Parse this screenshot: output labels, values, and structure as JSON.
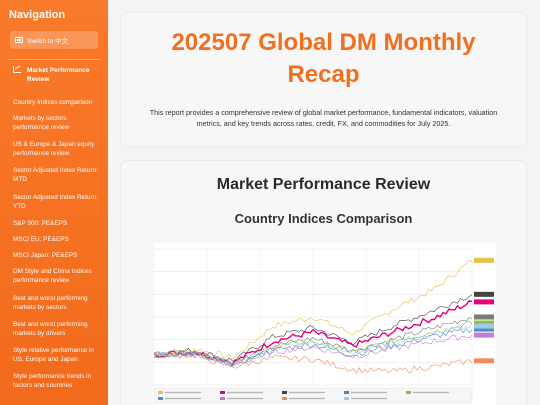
{
  "sidebar": {
    "title": "Navigation",
    "switch_label": "Switch to 中文",
    "active_item": "Market Performance Review",
    "items": [
      "Country Indices comparison",
      "Markets by sectors performance review",
      "US & Europe & Japan equity performance review",
      "Sector Adjusted Index Return: MTD",
      "Sector Adjusted Index Return: YTD",
      "S&P 500: PE&EPS",
      "MSCI EU: PE&EPS",
      "MSCI Japan: PE&EPS",
      "DM Style and China Indices performance review",
      "Best and worst performing markets by sectors",
      "Best and worst performing markets by drivers",
      "Style relative performance in US, Europe and Japan",
      "Style performance trends in factors and countries"
    ]
  },
  "header": {
    "title": "202507 Global DM Monthly Recap",
    "description": "This report provides a comprehensive review of global market performance, fundamental indicators, valuation metrics, and key trends across rates, credit, FX, and commodities for July 2025."
  },
  "section": {
    "title": "Market Performance Review",
    "subtitle": "Country Indices Comparison"
  },
  "chart_data": {
    "type": "line",
    "title": "",
    "xlabel": "",
    "ylabel": "",
    "x": [
      "2019",
      "2020",
      "2021",
      "2022",
      "2023",
      "2024",
      "2025"
    ],
    "grid": true,
    "legend_position": "bottom",
    "note": "Bloomberg multi-index total return comparison; legend and tick text too small to read",
    "series": [
      {
        "color": "#e6c24a",
        "values": [
          100,
          108,
          96,
          138,
          150,
          128,
          160,
          185,
          225
        ]
      },
      {
        "color": "#e6007e",
        "values": [
          100,
          104,
          90,
          118,
          130,
          112,
          130,
          148,
          170
        ]
      },
      {
        "color": "#444444",
        "values": [
          100,
          106,
          92,
          124,
          136,
          116,
          138,
          158,
          180
        ]
      },
      {
        "color": "#7a7a7a",
        "values": [
          100,
          103,
          88,
          112,
          122,
          105,
          120,
          135,
          150
        ]
      },
      {
        "color": "#8bbf3c",
        "values": [
          100,
          102,
          89,
          110,
          118,
          104,
          118,
          130,
          142
        ]
      },
      {
        "color": "#4a90c2",
        "values": [
          100,
          101,
          87,
          106,
          114,
          100,
          112,
          124,
          134
        ]
      },
      {
        "color": "#c47ad8",
        "values": [
          100,
          100,
          86,
          104,
          110,
          98,
          108,
          118,
          126
        ]
      },
      {
        "color": "#f08a60",
        "values": [
          100,
          99,
          84,
          96,
          94,
          80,
          78,
          84,
          92
        ]
      },
      {
        "color": "#9ec9ea",
        "values": [
          100,
          101,
          88,
          108,
          116,
          102,
          116,
          128,
          138
        ]
      }
    ]
  }
}
